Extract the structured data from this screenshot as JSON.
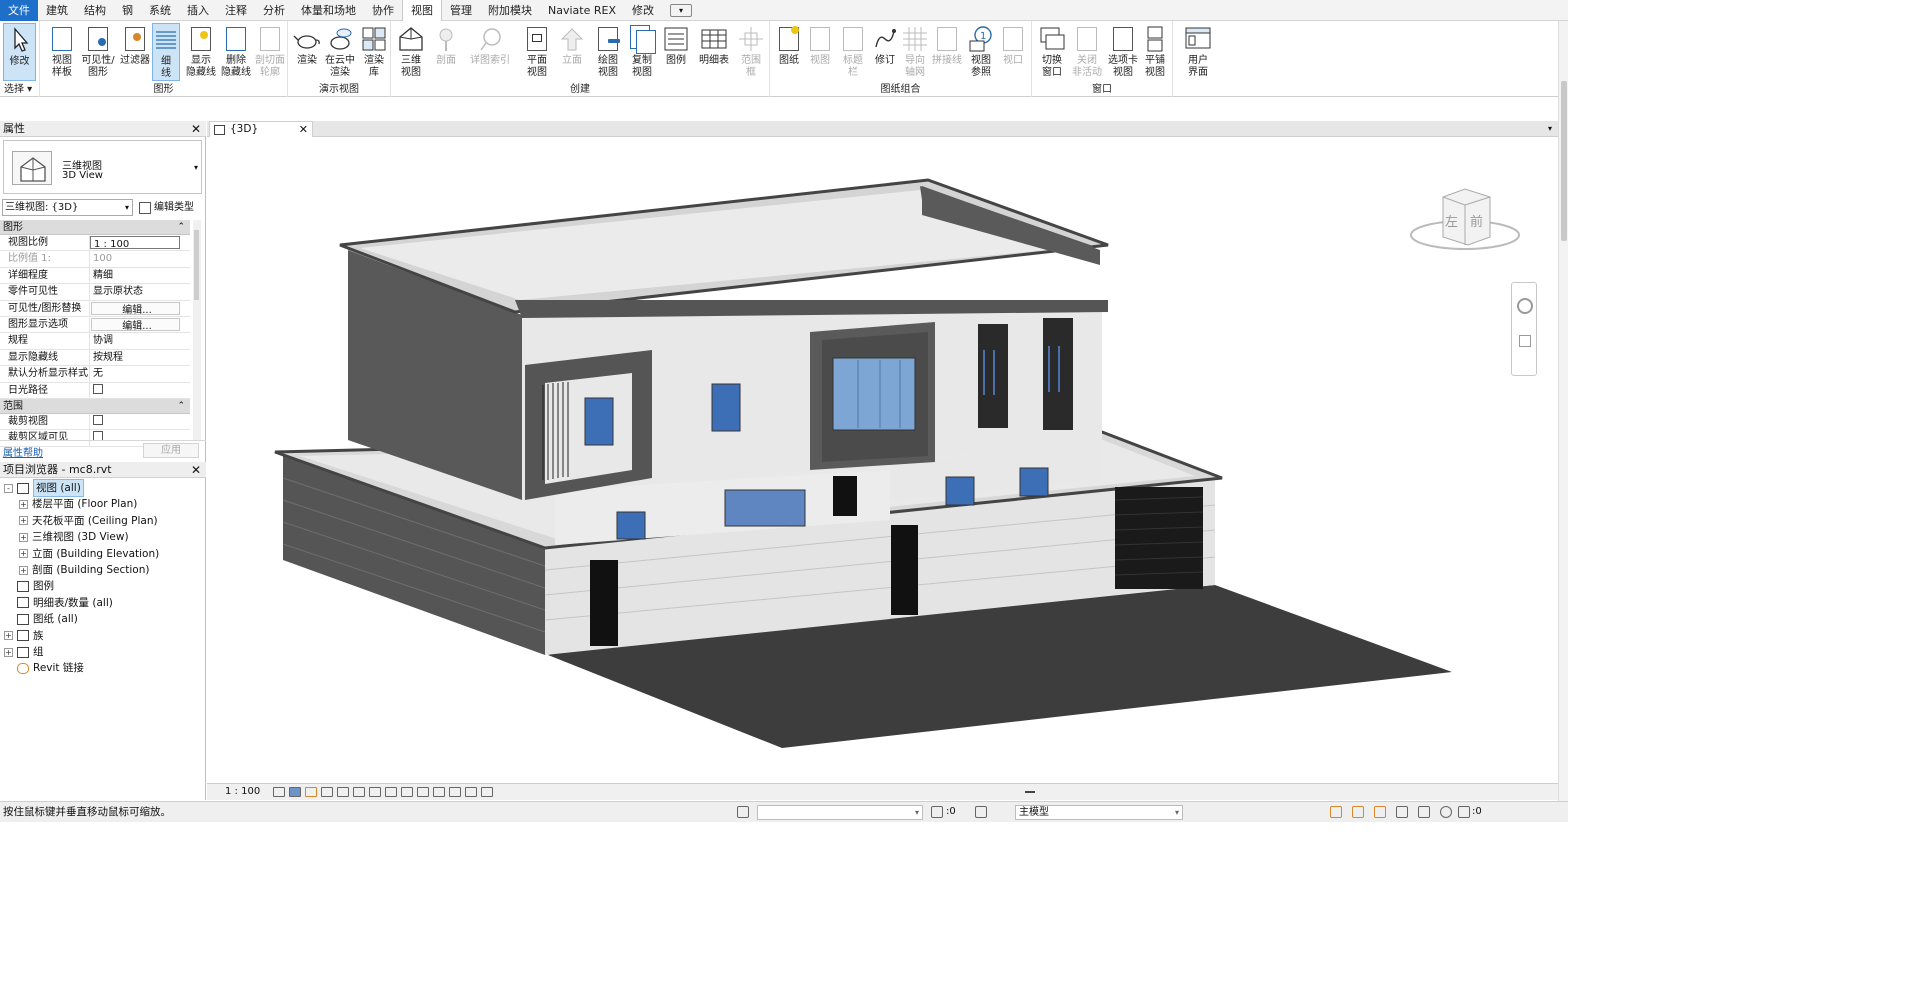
{
  "menu_tabs": [
    "文件",
    "建筑",
    "结构",
    "钢",
    "系统",
    "插入",
    "注释",
    "分析",
    "体量和场地",
    "协作",
    "视图",
    "管理",
    "附加模块",
    "Naviate REX",
    "修改"
  ],
  "active_tab": "视图",
  "ribbon": {
    "groups": {
      "select": "选择",
      "graphics": "图形",
      "presentation": "演示视图",
      "create": "创建",
      "sheet": "图纸组合",
      "windows": "窗口"
    },
    "buttons": {
      "modify": "修改",
      "view_template": "视图\n样板",
      "visibility": "可见性/\n图形",
      "filters": "过滤器",
      "thin_lines": "细\n线",
      "show_hidden": "显示\n隐藏线",
      "remove_hidden": "删除\n隐藏线",
      "cut_profile": "剖切面\n轮廓",
      "render": "渲染",
      "cloud_render": "在云中\n渲染",
      "render_gallery": "渲染\n库",
      "view_3d": "三维\n视图",
      "section": "剖面",
      "detail_callout": "详图索引",
      "plan_views": "平面\n视图",
      "elevation": "立面",
      "drafting_view": "绘图\n视图",
      "duplicate_view": "复制\n视图",
      "legends": "图例",
      "schedules": "明细表",
      "scope_box": "范围\n框",
      "sheet": "图纸",
      "view": "视图",
      "title_block": "标题\n栏",
      "revisions": "修订",
      "guide_grid": "导向\n轴网",
      "matchline": "拼接线",
      "view_reference": "视图\n参照",
      "viewports": "视口",
      "switch_windows": "切换\n窗口",
      "close_inactive": "关闭\n非活动",
      "tab_views": "选项卡\n视图",
      "tile_views": "平铺\n视图",
      "user_interface": "用户\n界面"
    }
  },
  "properties": {
    "title": "属性",
    "type_name_cn": "三维视图",
    "type_name_en": "3D View",
    "view_selector": "三维视图: {3D}",
    "edit_type": "编辑类型",
    "sections": [
      {
        "name": "图形",
        "rows": [
          {
            "key": "视图比例",
            "value": "1 : 100",
            "style": "box"
          },
          {
            "key": "比例值 1:",
            "value": "100",
            "style": "dim"
          },
          {
            "key": "详细程度",
            "value": "精细"
          },
          {
            "key": "零件可见性",
            "value": "显示原状态"
          },
          {
            "key": "可见性/图形替换",
            "value": "编辑...",
            "style": "btn"
          },
          {
            "key": "图形显示选项",
            "value": "编辑...",
            "style": "btn"
          },
          {
            "key": "规程",
            "value": "协调"
          },
          {
            "key": "显示隐藏线",
            "value": "按规程"
          },
          {
            "key": "默认分析显示样式",
            "value": "无"
          },
          {
            "key": "日光路径",
            "value": "",
            "style": "check"
          }
        ]
      },
      {
        "name": "范围",
        "rows": [
          {
            "key": "裁剪视图",
            "value": "",
            "style": "check"
          },
          {
            "key": "裁剪区域可见",
            "value": "",
            "style": "check"
          }
        ]
      }
    ],
    "help_link": "属性帮助",
    "apply": "应用"
  },
  "project_browser": {
    "title": "项目浏览器 - mc8.rvt",
    "items": [
      {
        "label": "视图 (all)",
        "level": 0,
        "pm": "-",
        "selected": true
      },
      {
        "label": "楼层平面 (Floor Plan)",
        "level": 1,
        "pm": "+"
      },
      {
        "label": "天花板平面 (Ceiling Plan)",
        "level": 1,
        "pm": "+"
      },
      {
        "label": "三维视图 (3D View)",
        "level": 1,
        "pm": "+"
      },
      {
        "label": "立面 (Building Elevation)",
        "level": 1,
        "pm": "+"
      },
      {
        "label": "剖面 (Building Section)",
        "level": 1,
        "pm": "+"
      },
      {
        "label": "图例",
        "level": 0,
        "pm": ""
      },
      {
        "label": "明细表/数量 (all)",
        "level": 0,
        "pm": ""
      },
      {
        "label": "图纸 (all)",
        "level": 0,
        "pm": ""
      },
      {
        "label": "族",
        "level": 0,
        "pm": "+"
      },
      {
        "label": "组",
        "level": 0,
        "pm": "+"
      },
      {
        "label": "Revit 链接",
        "level": 0,
        "pm": ""
      }
    ]
  },
  "view_tab": "{3D}",
  "viewcube": {
    "left": "左",
    "front": "前"
  },
  "view_scale": "1 : 100",
  "status": {
    "message": "按住鼠标键并垂直移动鼠标可缩放。",
    "zero1": ":0",
    "model": "主模型",
    "zero2": ":0"
  }
}
